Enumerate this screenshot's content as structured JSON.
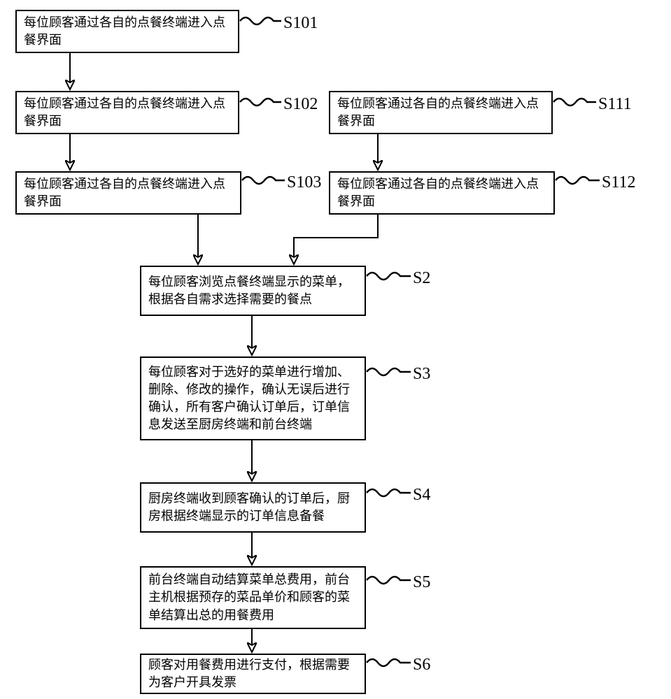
{
  "nodes": {
    "s101": {
      "text": "每位顾客通过各自的点餐终端进入点餐界面",
      "label": "S101"
    },
    "s102": {
      "text": "每位顾客通过各自的点餐终端进入点餐界面",
      "label": "S102"
    },
    "s103": {
      "text": "每位顾客通过各自的点餐终端进入点餐界面",
      "label": "S103"
    },
    "s111": {
      "text": "每位顾客通过各自的点餐终端进入点餐界面",
      "label": "S111"
    },
    "s112": {
      "text": "每位顾客通过各自的点餐终端进入点餐界面",
      "label": "S112"
    },
    "s2": {
      "text": "每位顾客浏览点餐终端显示的菜单，根据各自需求选择需要的餐点",
      "label": "S2"
    },
    "s3": {
      "text": "每位顾客对于选好的菜单进行增加、删除、修改的操作，确认无误后进行确认，所有客户确认订单后，订单信息发送至厨房终端和前台终端",
      "label": "S3"
    },
    "s4": {
      "text": "厨房终端收到顾客确认的订单后，厨房根据终端显示的订单信息备餐",
      "label": "S4"
    },
    "s5": {
      "text": "前台终端自动结算菜单总费用，前台主机根据预存的菜品单价和顾客的菜单结算出总的用餐费用",
      "label": "S5"
    },
    "s6": {
      "text": "顾客对用餐费用进行支付，根据需要为客户开具发票",
      "label": "S6"
    }
  }
}
